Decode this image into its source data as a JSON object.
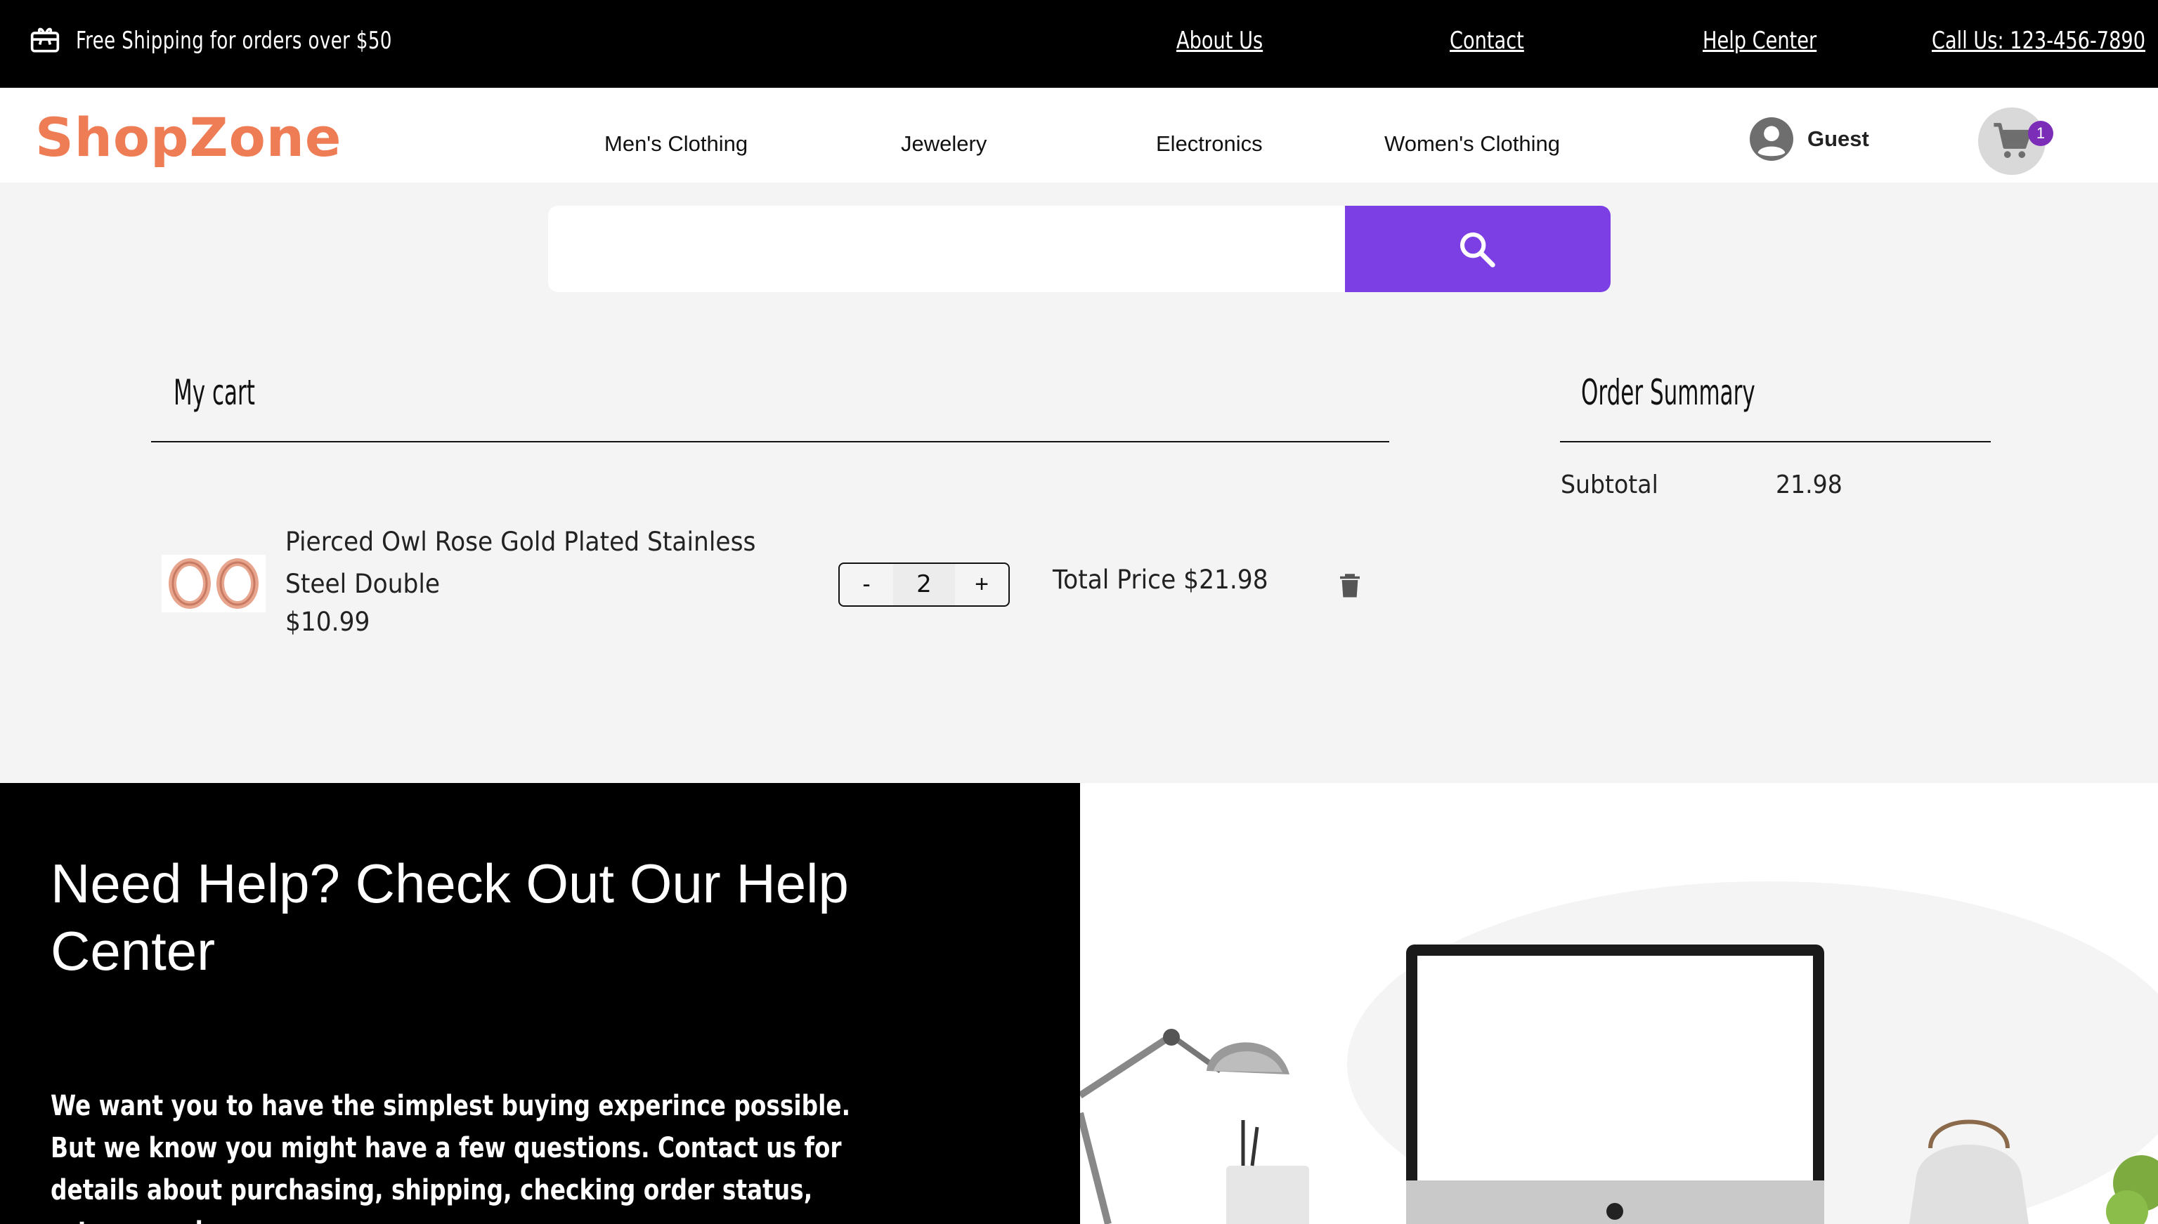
{
  "topbar": {
    "promo_text": "Free Shipping for orders over $50",
    "links": [
      "About Us",
      "Contact",
      "Help Center",
      "Call Us: 123-456-7890"
    ]
  },
  "header": {
    "logo": "ShopZone",
    "nav": [
      "Men's Clothing",
      "Jewelery",
      "Electronics",
      "Women's Clothing"
    ],
    "account_label": "Guest",
    "cart_count": "1"
  },
  "search": {
    "placeholder": ""
  },
  "cart": {
    "title": "My cart",
    "items": [
      {
        "name": "Pierced Owl Rose Gold Plated Stainless Steel Double",
        "price": "$10.99",
        "quantity": "2",
        "decrement_label": "-",
        "increment_label": "+",
        "total": "Total Price $21.98"
      }
    ]
  },
  "summary": {
    "title": "Order Summary",
    "subtotal_label": "Subtotal",
    "subtotal_value": "21.98"
  },
  "help": {
    "title": "Need Help? Check Out Our Help Center",
    "text": "We want you to have the simplest buying experince possible. But we know you might have a few questions. Contact us for details about purchasing, shipping, checking order status, returns and more."
  },
  "colors": {
    "brand": "#ee7c54",
    "search_button": "#7b3fe4",
    "badge": "#7b2db8",
    "topbar": "#000000"
  },
  "icons": {
    "promo": "gift-card-icon",
    "account": "user-avatar-icon",
    "cart": "shopping-cart-icon",
    "search": "search-icon",
    "delete": "trash-icon"
  }
}
